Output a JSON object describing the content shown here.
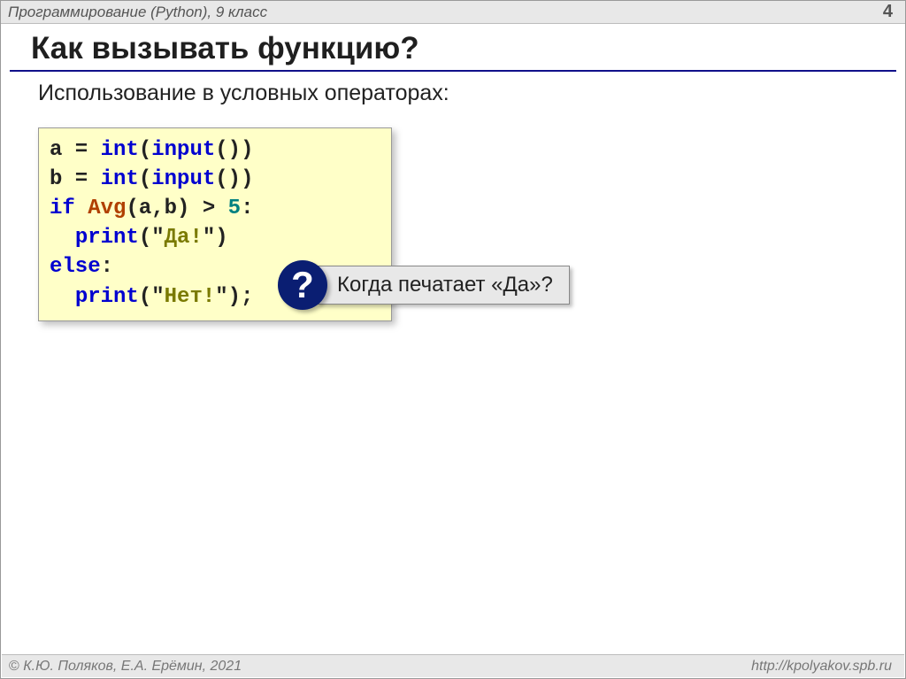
{
  "header": {
    "course": "Программирование (Python), 9 класс",
    "page_number": "4"
  },
  "title": "Как вызывать функцию?",
  "subtitle": "Использование в условных операторах:",
  "code": {
    "l1": {
      "a": "a",
      "eq": " = ",
      "int": "int",
      "p1": "(",
      "input": "input",
      "p2": "())"
    },
    "l2": {
      "b": "b",
      "eq": " = ",
      "int": "int",
      "p1": "(",
      "input": "input",
      "p2": "())"
    },
    "l3": {
      "if": "if",
      "sp": " ",
      "avg": "Avg",
      "args": "(a,b)",
      "gt": " > ",
      "five": "5",
      "colon": ":"
    },
    "l4": {
      "indent": "  ",
      "print": "print",
      "open": "(\"",
      "str": "Да!",
      "close": "\")"
    },
    "l5": {
      "else": "else",
      "colon": ":"
    },
    "l6": {
      "indent": "  ",
      "print": "print",
      "open": "(\"",
      "str": "Нет!",
      "close": "\");"
    }
  },
  "callout": {
    "badge": "?",
    "text": "Когда печатает «Да»?"
  },
  "footer": {
    "copyright": "К.Ю. Поляков, Е.А. Ерёмин, 2021",
    "url": "http://kpolyakov.spb.ru"
  }
}
